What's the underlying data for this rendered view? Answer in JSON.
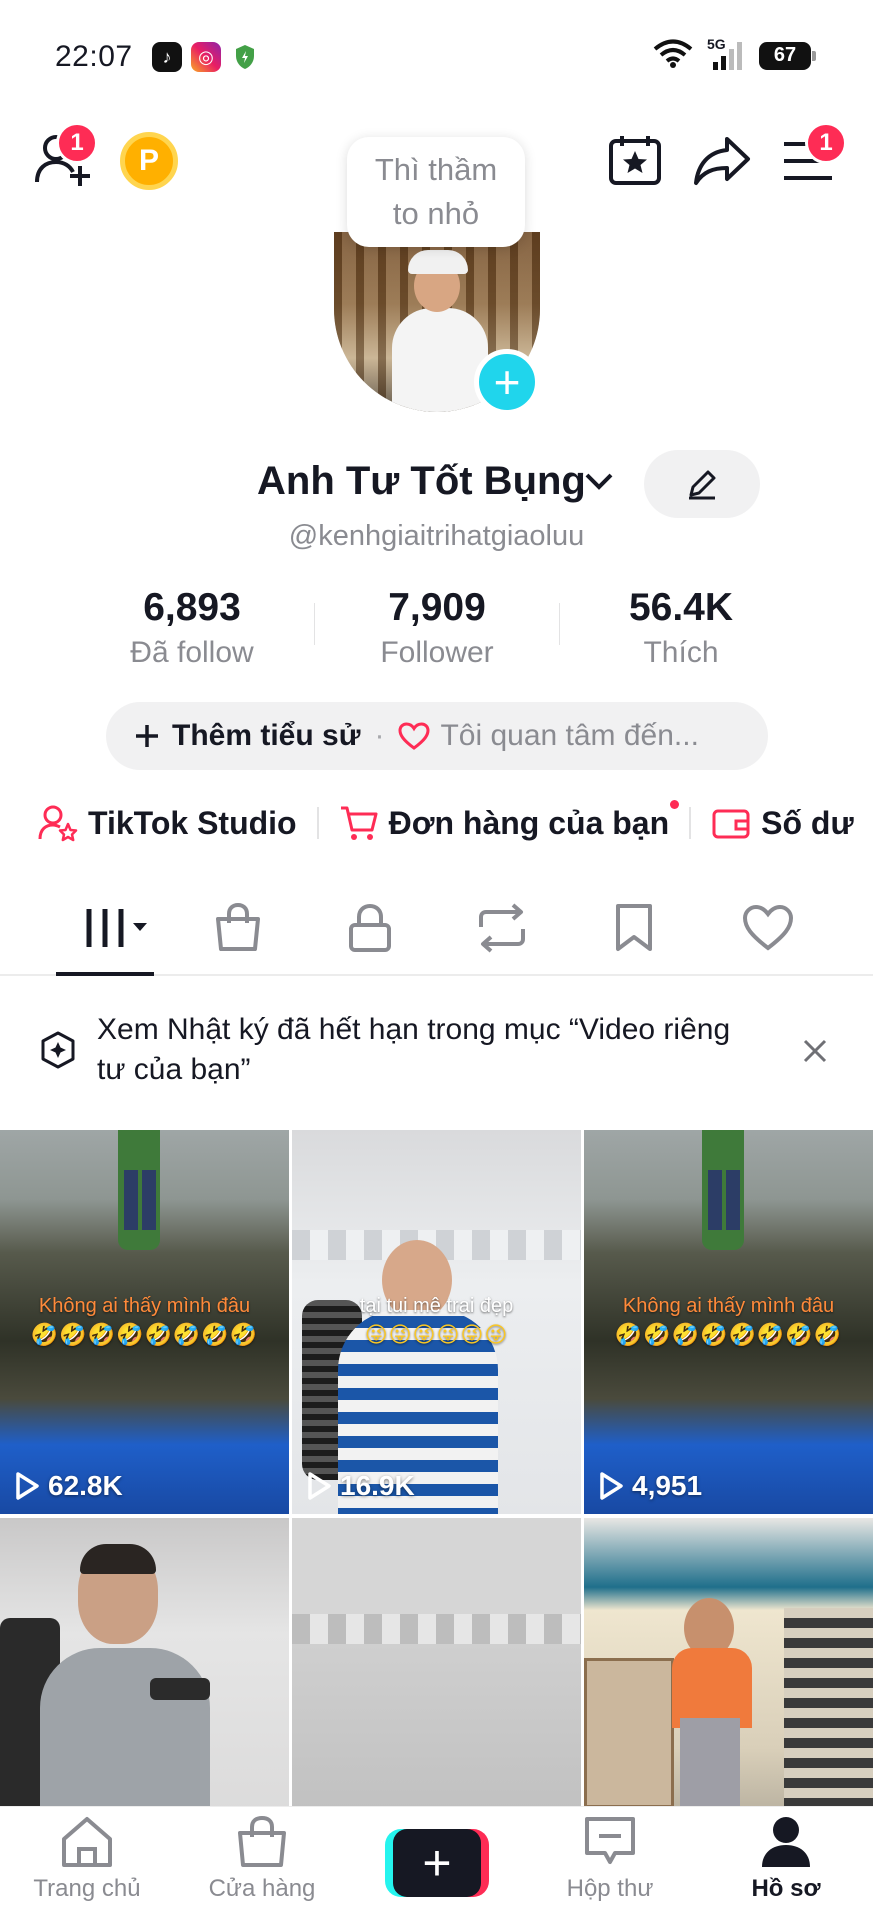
{
  "status_bar": {
    "time": "22:07",
    "network": "5G",
    "battery": "67"
  },
  "top_bar": {
    "add_friends_badge": "1",
    "coin_label": "P",
    "menu_badge": "1"
  },
  "avatar": {
    "tooltip_line1": "Thì thầm",
    "tooltip_line2": "to nhỏ"
  },
  "profile": {
    "display_name": "Anh Tư Tốt Bụng",
    "handle": "@kenhgiaitrihatgiaoluu"
  },
  "stats": [
    {
      "value": "6,893",
      "label": "Đã follow"
    },
    {
      "value": "7,909",
      "label": "Follower"
    },
    {
      "value": "56.4K",
      "label": "Thích"
    }
  ],
  "bio": {
    "add_label": "Thêm tiểu sử",
    "separator": "·",
    "interest_label": "Tôi quan tâm đến..."
  },
  "shortcuts": [
    {
      "label": "TikTok Studio"
    },
    {
      "label": "Đơn hàng của bạn"
    },
    {
      "label": "Số dư"
    }
  ],
  "notice": {
    "text": "Xem Nhật ký đã hết hạn trong mục “Video riêng tư của bạn”"
  },
  "videos": [
    {
      "views": "62.8K",
      "caption": "Không  ai thấy mình đâu",
      "emojis": "🤣🤣🤣🤣🤣🤣🤣🤣"
    },
    {
      "views": "16.9K",
      "caption": "tại tui mê trai đẹp",
      "emojis": "😜😜😜😜😜😜"
    },
    {
      "views": "4,951",
      "caption": "Không  ai thấy mình đâu",
      "emojis": "🤣🤣🤣🤣🤣🤣🤣🤣"
    },
    {
      "views": "",
      "caption": "",
      "emojis": ""
    },
    {
      "views": "",
      "caption": "",
      "emojis": ""
    },
    {
      "views": "",
      "caption": "",
      "emojis": ""
    }
  ],
  "bottom_nav": {
    "home": "Trang chủ",
    "shop": "Cửa hàng",
    "create": "+",
    "inbox": "Hộp thư",
    "profile": "Hồ sơ"
  },
  "colors": {
    "accent_red": "#fe2c55",
    "accent_cyan": "#20d5ec",
    "text_primary": "#161823",
    "text_secondary": "#8a8b91",
    "coin": "#ffb000"
  }
}
